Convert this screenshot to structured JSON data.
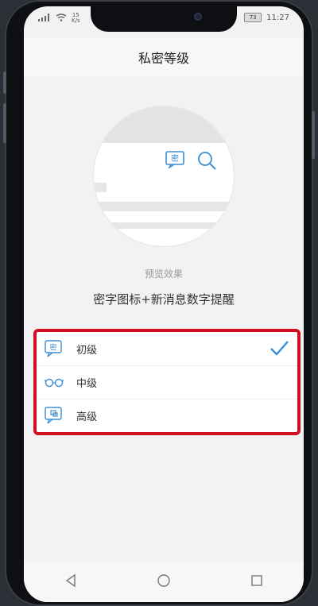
{
  "status_bar": {
    "signal_icon": "signal-icon",
    "wifi_icon": "wifi-icon",
    "net_speed_value": "15",
    "net_speed_unit": "K/s",
    "battery_level": "73",
    "time": "11:27"
  },
  "header": {
    "title": "私密等级"
  },
  "preview": {
    "caption": "预览效果",
    "description": "密字图标+新消息数字提醒",
    "icons": [
      "secret-chat-icon",
      "search-icon"
    ]
  },
  "levels": [
    {
      "label": "初级",
      "icon": "secret-chat-icon",
      "selected": true
    },
    {
      "label": "中级",
      "icon": "glasses-icon",
      "selected": false
    },
    {
      "label": "高级",
      "icon": "message-square-icon",
      "selected": false
    }
  ],
  "colors": {
    "accent_blue": "#3a8fd6",
    "highlight_red": "#d20f20"
  },
  "nav": [
    "back-icon",
    "home-icon",
    "recents-icon"
  ]
}
